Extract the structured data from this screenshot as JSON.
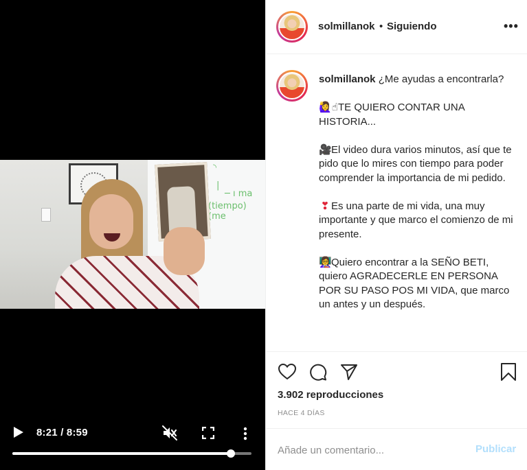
{
  "video": {
    "time_display": "8:21 / 8:59",
    "progress_fraction": 0.915,
    "muted": true
  },
  "header": {
    "username": "solmillanok",
    "separator": "•",
    "follow_status": "Siguiendo",
    "more_label": "•••"
  },
  "caption": {
    "username": "solmillanok",
    "paragraphs": [
      "¿Me ayudas a encontrarla?",
      "TE QUIERO CONTAR UNA HISTORIA...",
      "El video dura varios minutos, así que te pido que lo mires con tiempo para poder comprender la importancia de mi pedido.",
      "Es una parte de mi vida, una muy importante y que marco el comienzo de mi presente.",
      "Quiero encontrar a la SEÑO BETI, quiero AGRADECERLE EN PERSONA POR SU PASO POS MI VIDA, que marco un antes y un después."
    ],
    "emojis": [
      "🙋‍♀️☝",
      "🎥",
      "❣",
      "👩‍🏫"
    ]
  },
  "stats": {
    "views": "3.902 reproducciones",
    "date": "HACE 4 DÍAS"
  },
  "comment": {
    "placeholder": "Añade un comentario...",
    "publish_label": "Publicar"
  },
  "colors": {
    "publish_disabled": "#b2dffc",
    "secondary_text": "#8e8e8e",
    "divider": "#efefef"
  }
}
